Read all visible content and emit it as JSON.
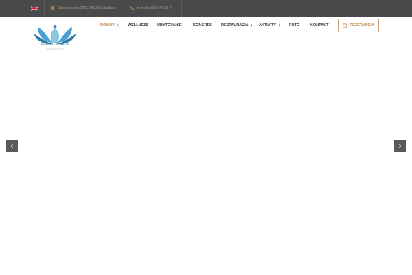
{
  "topbar": {
    "language_flag": "uk-flag-icon",
    "address": "Rajecká cesta 20/2, 941 31 Palárikovo",
    "contact": "Kontakt: 035 649 01 44"
  },
  "logo": {
    "title": "Wellness & Relax",
    "subtitle": "PALÁRIKOVO"
  },
  "nav": {
    "items": [
      {
        "label": "DOMOV",
        "has_sub": true,
        "active": true
      },
      {
        "label": "WELLNESS",
        "has_sub": false
      },
      {
        "label": "UBYTOVANIE",
        "has_sub": false
      },
      {
        "label": "KONGRES",
        "has_sub": false
      },
      {
        "label": "REŠTAURÁCIA",
        "has_sub": true
      },
      {
        "label": "AKTIVITY",
        "has_sub": true
      },
      {
        "label": "FOTO",
        "has_sub": false
      },
      {
        "label": "KONTAKT",
        "has_sub": false
      }
    ],
    "reserve_label": "REZERVÁCIA"
  },
  "slider": {
    "prev_icon": "chevron-left-icon",
    "next_icon": "chevron-right-icon"
  },
  "colors": {
    "accent": "#c4813f",
    "topbar_bg": "#4a4a4a",
    "logo_blue": "#2f7aa0"
  }
}
